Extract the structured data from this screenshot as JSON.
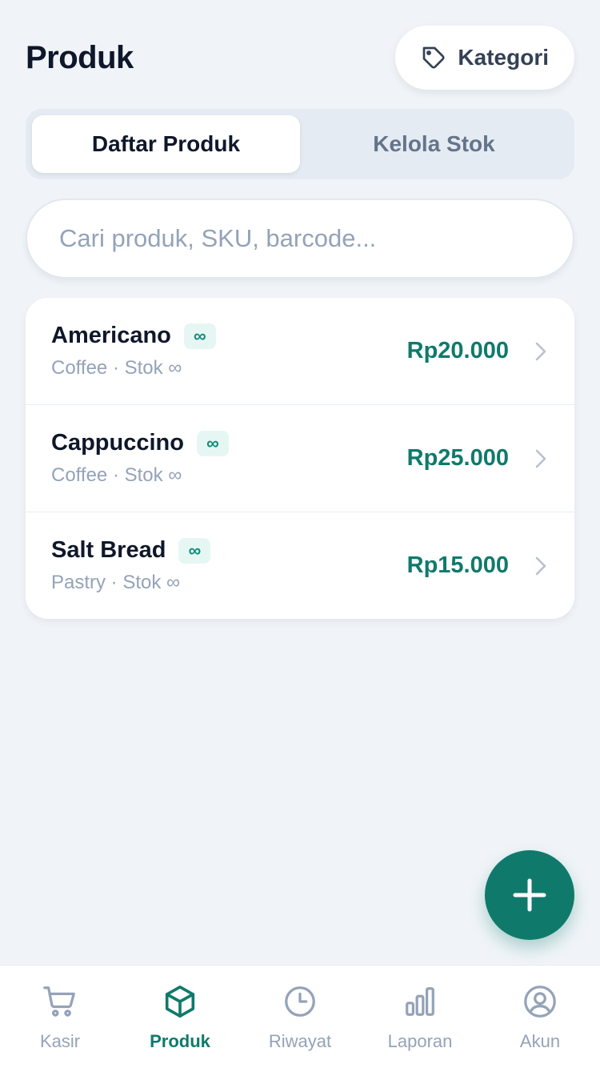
{
  "header": {
    "title": "Produk",
    "kategori_label": "Kategori",
    "kategori_icon": "tag-icon"
  },
  "segments": [
    {
      "label": "Daftar Produk",
      "active": true
    },
    {
      "label": "Kelola Stok",
      "active": false
    }
  ],
  "search": {
    "placeholder": "Cari produk, SKU, barcode...",
    "value": ""
  },
  "products": [
    {
      "name": "Americano",
      "badge": "∞",
      "subtitle": "Coffee · Stok ∞",
      "price": "Rp20.000"
    },
    {
      "name": "Cappuccino",
      "badge": "∞",
      "subtitle": "Coffee · Stok ∞",
      "price": "Rp25.000"
    },
    {
      "name": "Salt Bread",
      "badge": "∞",
      "subtitle": "Pastry · Stok ∞",
      "price": "Rp15.000"
    }
  ],
  "fab": {
    "icon": "plus-icon"
  },
  "tabbar": [
    {
      "label": "Kasir",
      "icon": "cart-icon",
      "active": false
    },
    {
      "label": "Produk",
      "icon": "box-icon",
      "active": true
    },
    {
      "label": "Riwayat",
      "icon": "clock-icon",
      "active": false
    },
    {
      "label": "Laporan",
      "icon": "bar-chart-icon",
      "active": false
    },
    {
      "label": "Akun",
      "icon": "user-circle-icon",
      "active": false
    }
  ],
  "colors": {
    "accent": "#0f7a6b",
    "background": "#f0f4f8",
    "muted": "#94a3b8"
  }
}
